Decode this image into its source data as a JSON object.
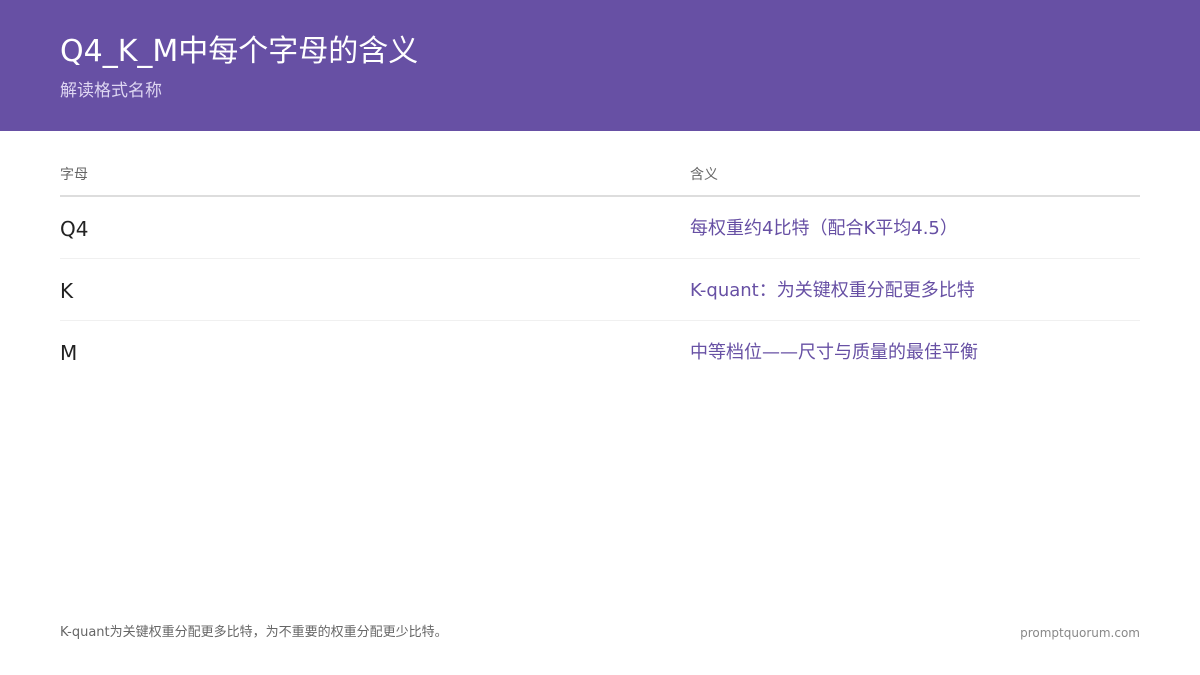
{
  "header": {
    "title": "Q4_K_M中每个字母的含义",
    "subtitle": "解读格式名称"
  },
  "table": {
    "columns": [
      "字母",
      "含义"
    ],
    "rows": [
      {
        "letter": "Q4",
        "meaning": "每权重约4比特（配合K平均4.5）"
      },
      {
        "letter": "K",
        "meaning": "K-quant：为关键权重分配更多比特"
      },
      {
        "letter": "M",
        "meaning": "中等档位——尺寸与质量的最佳平衡"
      }
    ]
  },
  "footer": {
    "note": "K-quant为关键权重分配更多比特，为不重要的权重分配更少比特。",
    "site": "promptquorum.com"
  },
  "colors": {
    "accent": "#6750a4",
    "header_text": "#ffffff",
    "subtitle_text": "#ded6f2",
    "body_text": "#222222",
    "muted_text": "#666666"
  }
}
